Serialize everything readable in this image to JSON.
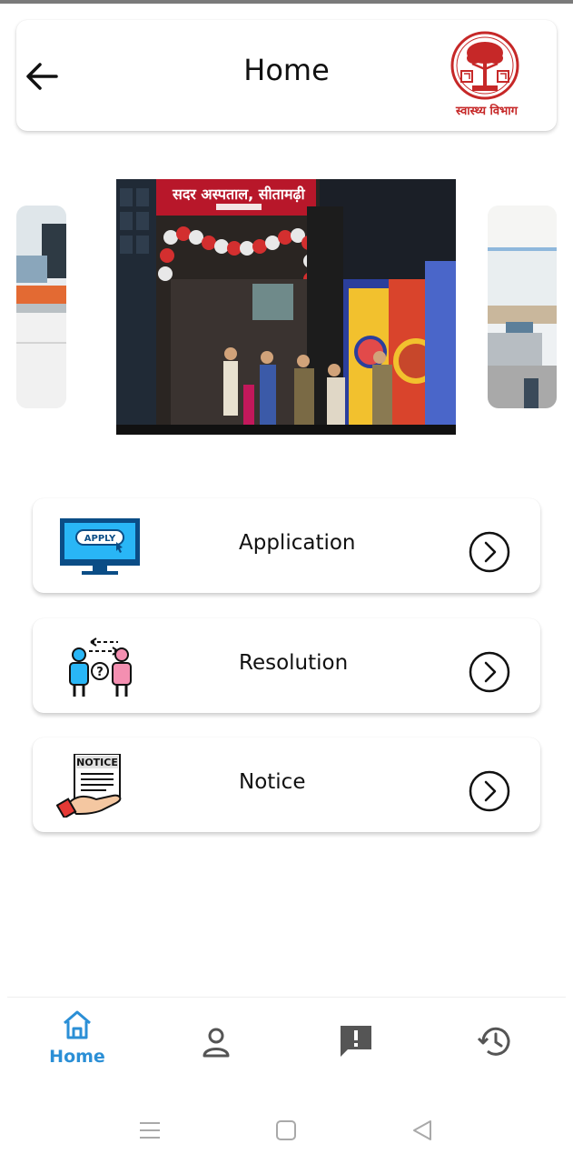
{
  "header": {
    "title": "Home",
    "logo_text": "स्वास्थ्य विभाग"
  },
  "carousel": {
    "banner_text": "सदर अस्पताल, सीतामढ़ी"
  },
  "menu": [
    {
      "label": "Application",
      "icon": "apply-monitor-icon",
      "icon_text": "APPLY"
    },
    {
      "label": "Resolution",
      "icon": "resolution-people-icon"
    },
    {
      "label": "Notice",
      "icon": "notice-board-icon",
      "icon_text": "NOTICE"
    }
  ],
  "bottom_nav": {
    "items": [
      {
        "label": "Home",
        "icon": "home-icon",
        "active": true
      },
      {
        "label": "",
        "icon": "profile-icon"
      },
      {
        "label": "",
        "icon": "feedback-icon"
      },
      {
        "label": "",
        "icon": "history-icon"
      }
    ]
  },
  "colors": {
    "accent": "#2b8fd6",
    "logo_red": "#c62828"
  }
}
